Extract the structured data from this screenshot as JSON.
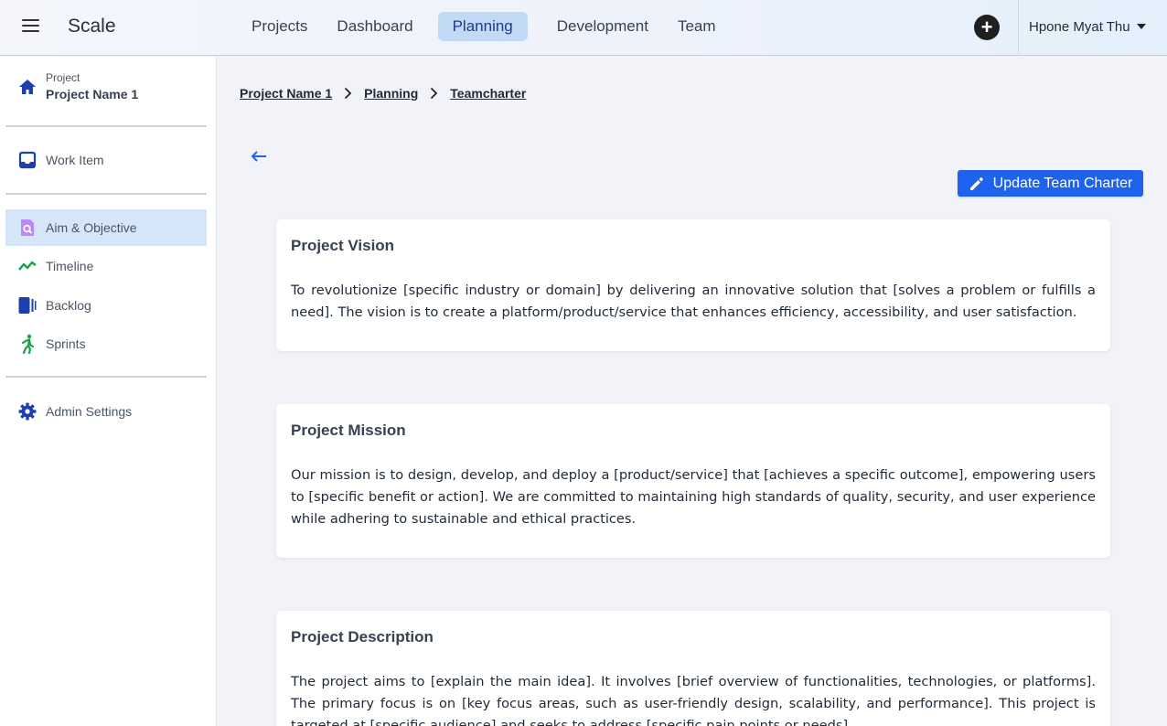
{
  "app": {
    "name": "Scale"
  },
  "nav": {
    "items": [
      "Projects",
      "Dashboard",
      "Planning",
      "Development",
      "Team"
    ],
    "active": "Planning"
  },
  "user": {
    "name": "Hpone Myat Thu"
  },
  "sidebar": {
    "project_caption": "Project",
    "project_name": "Project Name 1",
    "items": [
      {
        "label": "Work Item",
        "icon": "inbox-icon"
      },
      {
        "label": "Aim & Objective",
        "icon": "document-search-icon"
      },
      {
        "label": "Timeline",
        "icon": "trending-line-icon"
      },
      {
        "label": "Backlog",
        "icon": "backlog-icon"
      },
      {
        "label": "Sprints",
        "icon": "running-person-icon"
      },
      {
        "label": "Admin Settings",
        "icon": "gear-icon"
      }
    ],
    "active": "Aim & Objective"
  },
  "breadcrumb": [
    "Project Name 1",
    "Planning",
    "Teamcharter"
  ],
  "actions": {
    "update_label": "Update Team Charter"
  },
  "cards": [
    {
      "title": "Project Vision",
      "body": "To revolutionize [specific industry or domain] by delivering an innovative solution that [solves a problem or fulfills a need]. The vision is to create a platform/product/service that enhances efficiency, accessibility, and user satisfaction."
    },
    {
      "title": "Project Mission",
      "body": "Our mission is to design, develop, and deploy a [product/service] that [achieves a specific outcome], empowering users to [specific benefit or action]. We are committed to maintaining high standards of quality, security, and user experience while adhering to sustainable and ethical practices."
    },
    {
      "title": "Project Description",
      "body": "The project aims to [explain the main idea]. It involves [brief overview of functionalities, technologies, or platforms]. The primary focus is on [key focus areas, such as user-friendly design, scalability, and performance]. This project is targeted at [specific audience] and seeks to address [specific pain points or needs]."
    }
  ],
  "colors": {
    "primary": "#1f63ec",
    "active_nav": "#c2daf5",
    "active_sidebar": "#d6e6fa",
    "icon_blue": "#1e40af",
    "icon_green": "#16a34a",
    "icon_purple": "#a855f7"
  }
}
